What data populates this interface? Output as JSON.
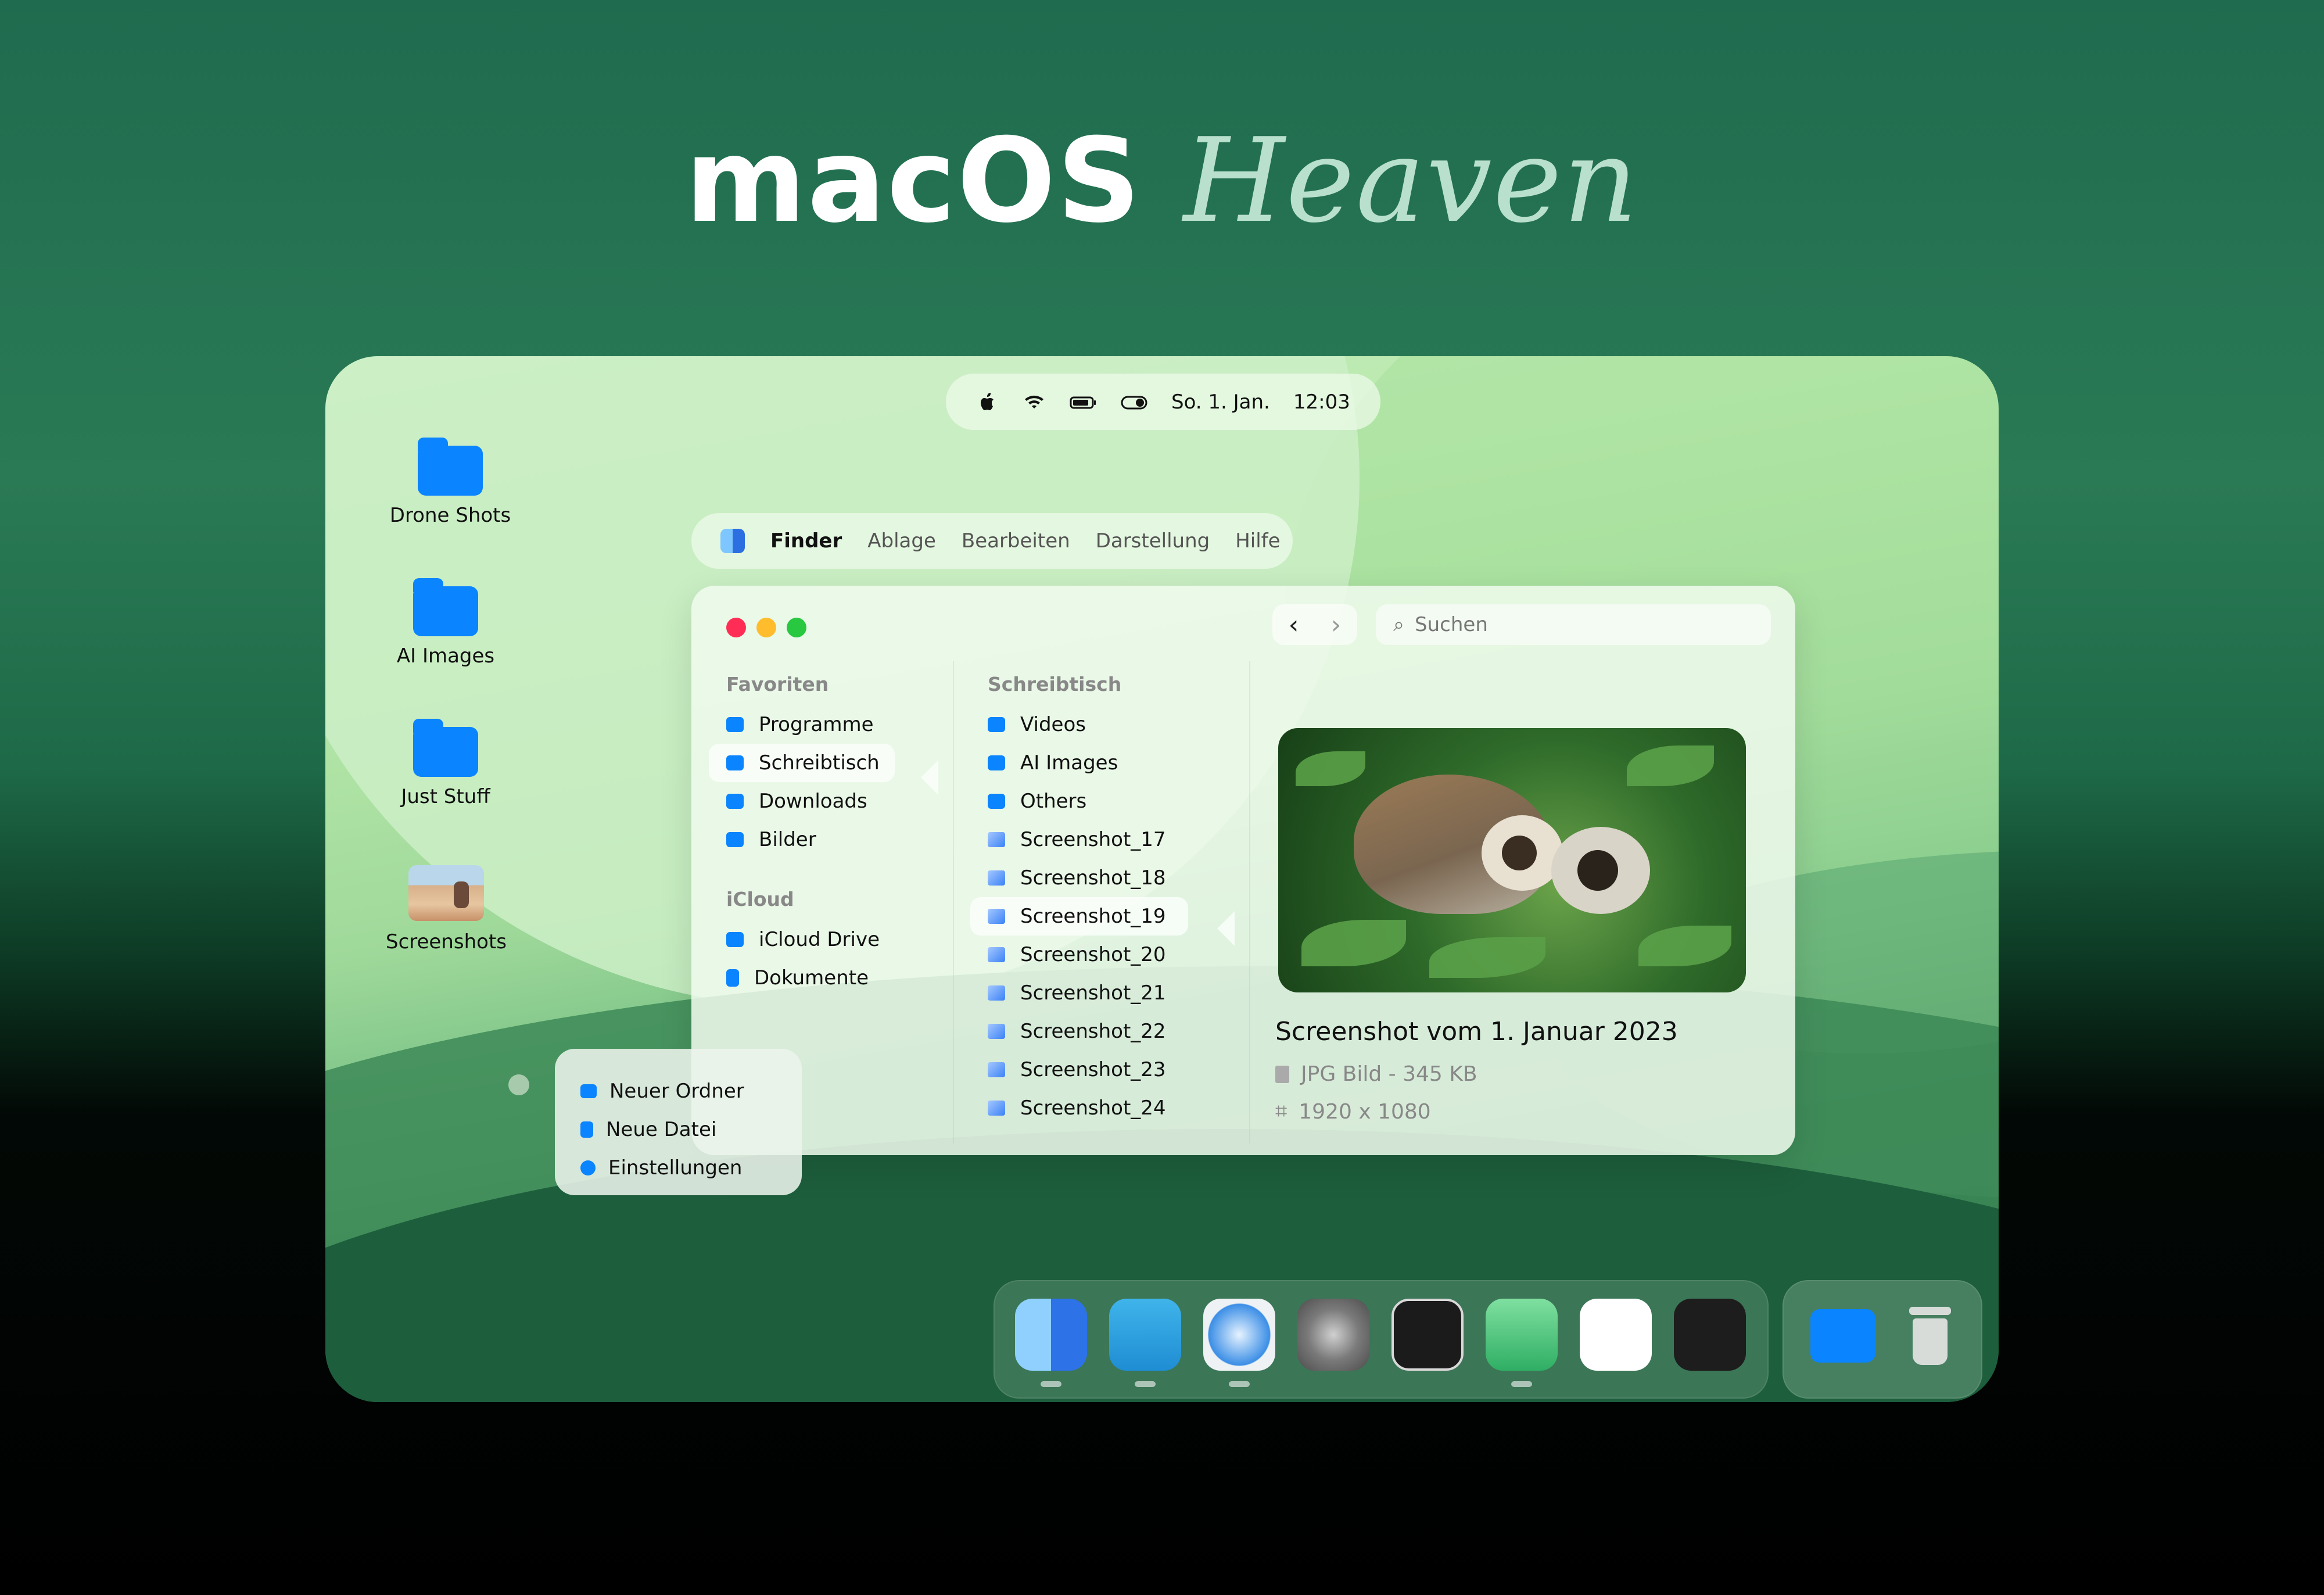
{
  "headline": {
    "main": "macOS",
    "accent": "Heaven"
  },
  "menubar": {
    "date": "So. 1. Jan.",
    "time": "12:03"
  },
  "desktop_items": [
    {
      "label": "Drone Shots"
    },
    {
      "label": "AI Images"
    },
    {
      "label": "Just Stuff"
    },
    {
      "label": "Screenshots"
    }
  ],
  "finder_menu": {
    "app": "Finder",
    "items": [
      "Ablage",
      "Bearbeiten",
      "Darstellung",
      "Hilfe"
    ]
  },
  "window": {
    "search_placeholder": "Suchen",
    "sidebar": {
      "favorites_title": "Favoriten",
      "favorites": [
        "Programme",
        "Schreibtisch",
        "Downloads",
        "Bilder"
      ],
      "icloud_title": "iCloud",
      "icloud": [
        "iCloud Drive",
        "Dokumente"
      ]
    },
    "column": {
      "title": "Schreibtisch",
      "items": [
        "Videos",
        "AI Images",
        "Others",
        "Screenshot_17",
        "Screenshot_18",
        "Screenshot_19",
        "Screenshot_20",
        "Screenshot_21",
        "Screenshot_22",
        "Screenshot_23",
        "Screenshot_24"
      ]
    },
    "preview": {
      "title": "Screenshot vom 1. Januar 2023",
      "type": "JPG Bild - 345 KB",
      "dimensions": "1920 x 1080"
    }
  },
  "context_menu": [
    "Neuer Ordner",
    "Neue Datei",
    "Einstellungen"
  ],
  "dock": [
    "finder",
    "telegram",
    "safari",
    "system-settings",
    "terminal",
    "atom",
    "vscode",
    "figma",
    "downloads-folder",
    "trash"
  ],
  "colors": {
    "accent": "#0a84ff",
    "close": "#ff3b30",
    "minimize": "#ffbd2e",
    "zoom": "#28c840"
  }
}
